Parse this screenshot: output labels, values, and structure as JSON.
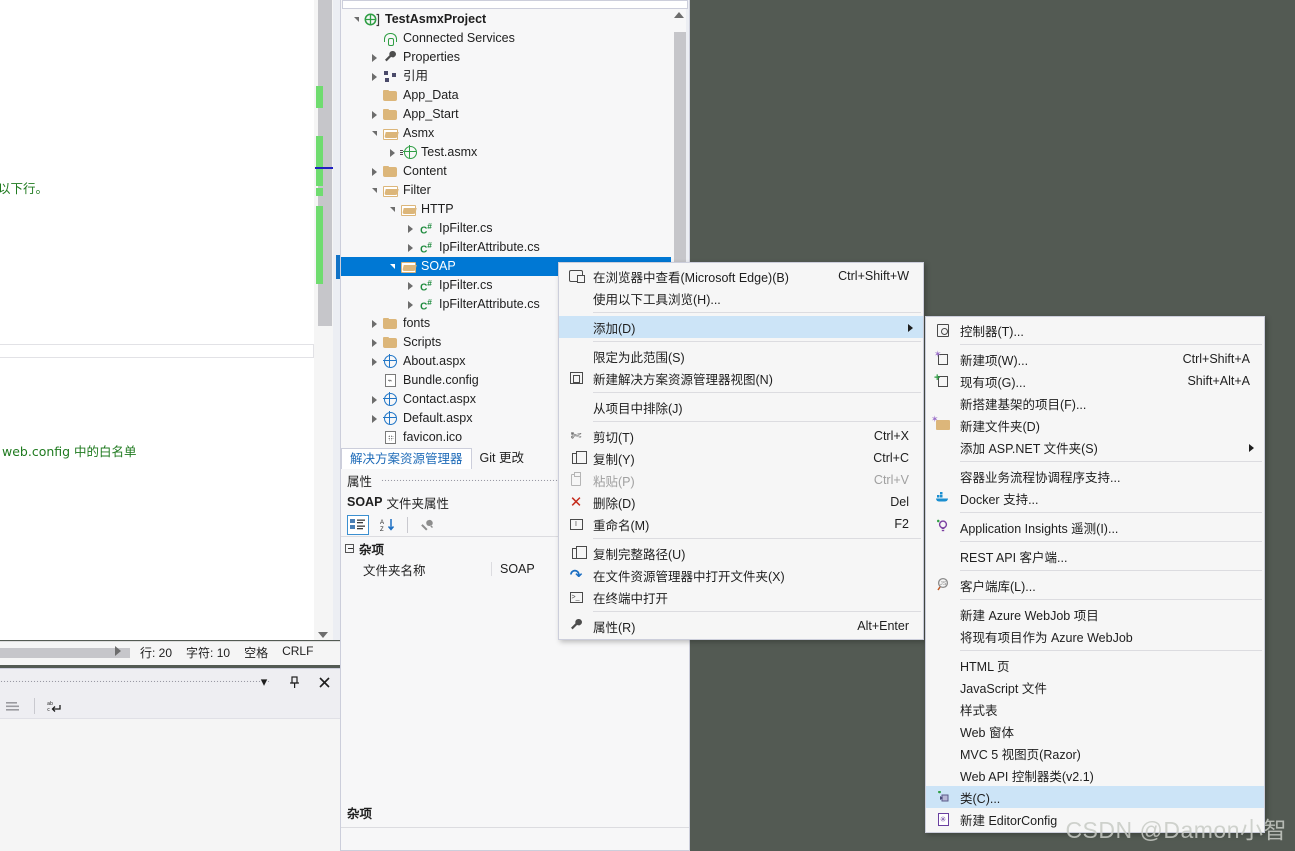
{
  "editor": {
    "comment_line_1": "以下行。",
    "comment_line_2": "web.config 中的白名单",
    "status": {
      "line_label": "行: 20",
      "char_label": "字符: 10",
      "spaces_label": "空格",
      "eol_label": "CRLF"
    }
  },
  "solution_explorer": {
    "tree": [
      {
        "indent": 0,
        "expander": "down",
        "icon": "project-icon",
        "label": "TestAsmxProject",
        "bold": true
      },
      {
        "indent": 1,
        "expander": "none",
        "icon": "connected-services-icon",
        "label": "Connected Services"
      },
      {
        "indent": 1,
        "expander": "right",
        "icon": "wrench-icon",
        "label": "Properties"
      },
      {
        "indent": 1,
        "expander": "right",
        "icon": "references-icon",
        "label": "引用"
      },
      {
        "indent": 1,
        "expander": "none",
        "icon": "folder-icon",
        "label": "App_Data"
      },
      {
        "indent": 1,
        "expander": "right",
        "icon": "folder-icon",
        "label": "App_Start"
      },
      {
        "indent": 1,
        "expander": "down",
        "icon": "folder-open-icon",
        "label": "Asmx"
      },
      {
        "indent": 2,
        "expander": "right",
        "icon": "asmx-icon",
        "label": "Test.asmx"
      },
      {
        "indent": 1,
        "expander": "right",
        "icon": "folder-icon",
        "label": "Content"
      },
      {
        "indent": 1,
        "expander": "down",
        "icon": "folder-open-icon",
        "label": "Filter"
      },
      {
        "indent": 2,
        "expander": "down",
        "icon": "folder-open-icon",
        "label": "HTTP"
      },
      {
        "indent": 3,
        "expander": "right",
        "icon": "csharp-icon",
        "label": "IpFilter.cs"
      },
      {
        "indent": 3,
        "expander": "right",
        "icon": "csharp-icon",
        "label": "IpFilterAttribute.cs"
      },
      {
        "indent": 2,
        "expander": "down",
        "icon": "folder-open-icon",
        "label": "SOAP",
        "selected": true
      },
      {
        "indent": 3,
        "expander": "right",
        "icon": "csharp-icon",
        "label": "IpFilter.cs"
      },
      {
        "indent": 3,
        "expander": "right",
        "icon": "csharp-icon",
        "label": "IpFilterAttribute.cs"
      },
      {
        "indent": 1,
        "expander": "right",
        "icon": "folder-icon",
        "label": "fonts"
      },
      {
        "indent": 1,
        "expander": "right",
        "icon": "folder-icon",
        "label": "Scripts"
      },
      {
        "indent": 1,
        "expander": "right",
        "icon": "aspx-icon",
        "label": "About.aspx"
      },
      {
        "indent": 1,
        "expander": "none",
        "icon": "config-icon",
        "label": "Bundle.config"
      },
      {
        "indent": 1,
        "expander": "right",
        "icon": "aspx-icon",
        "label": "Contact.aspx"
      },
      {
        "indent": 1,
        "expander": "right",
        "icon": "aspx-icon",
        "label": "Default.aspx"
      },
      {
        "indent": 1,
        "expander": "none",
        "icon": "favicon-icon",
        "label": "favicon.ico"
      }
    ],
    "tabs": [
      {
        "label": "解决方案资源管理器",
        "active": true
      },
      {
        "label": "Git 更改",
        "active": false
      }
    ]
  },
  "properties_window": {
    "title": "属性",
    "object_name": "SOAP",
    "object_kind": "文件夹属性",
    "category": "杂项",
    "rows": [
      {
        "key": "文件夹名称",
        "value": "SOAP"
      }
    ],
    "footer_label": "杂项"
  },
  "context_menu": {
    "items": [
      {
        "icon": "browser-icon",
        "label": "在浏览器中查看(Microsoft Edge)(B)",
        "shortcut": "Ctrl+Shift+W"
      },
      {
        "icon": "none",
        "label": "使用以下工具浏览(H)...",
        "shortcut": ""
      },
      {
        "type": "separator"
      },
      {
        "icon": "none",
        "label": "添加(D)",
        "shortcut": "",
        "highlighted": true,
        "submenu": true
      },
      {
        "type": "separator"
      },
      {
        "icon": "none",
        "label": "限定为此范围(S)",
        "shortcut": ""
      },
      {
        "icon": "new-view-icon",
        "label": "新建解决方案资源管理器视图(N)",
        "shortcut": ""
      },
      {
        "type": "separator"
      },
      {
        "icon": "none",
        "label": "从项目中排除(J)",
        "shortcut": ""
      },
      {
        "type": "separator"
      },
      {
        "icon": "scissors-icon",
        "label": "剪切(T)",
        "shortcut": "Ctrl+X"
      },
      {
        "icon": "copy-icon",
        "label": "复制(Y)",
        "shortcut": "Ctrl+C"
      },
      {
        "icon": "paste-icon",
        "label": "粘贴(P)",
        "shortcut": "Ctrl+V",
        "disabled": true
      },
      {
        "icon": "delete-icon",
        "label": "删除(D)",
        "shortcut": "Del"
      },
      {
        "icon": "rename-icon",
        "label": "重命名(M)",
        "shortcut": "F2"
      },
      {
        "type": "separator"
      },
      {
        "icon": "copy-icon",
        "label": "复制完整路径(U)",
        "shortcut": ""
      },
      {
        "icon": "open-folder-icon",
        "label": "在文件资源管理器中打开文件夹(X)",
        "shortcut": ""
      },
      {
        "icon": "terminal-icon",
        "label": "在终端中打开",
        "shortcut": ""
      },
      {
        "type": "separator"
      },
      {
        "icon": "wrench-icon",
        "label": "属性(R)",
        "shortcut": "Alt+Enter"
      }
    ]
  },
  "add_submenu": {
    "items": [
      {
        "icon": "controller-icon",
        "label": "控制器(T)...",
        "shortcut": ""
      },
      {
        "type": "separator"
      },
      {
        "icon": "new-item-icon",
        "label": "新建项(W)...",
        "shortcut": "Ctrl+Shift+A"
      },
      {
        "icon": "existing-item-icon",
        "label": "现有项(G)...",
        "shortcut": "Shift+Alt+A"
      },
      {
        "icon": "none",
        "label": "新搭建基架的项目(F)...",
        "shortcut": ""
      },
      {
        "icon": "new-folder-icon",
        "label": "新建文件夹(D)",
        "shortcut": ""
      },
      {
        "icon": "none",
        "label": "添加 ASP.NET 文件夹(S)",
        "shortcut": "",
        "submenu": true
      },
      {
        "type": "separator"
      },
      {
        "icon": "none",
        "label": "容器业务流程协调程序支持...",
        "shortcut": ""
      },
      {
        "icon": "docker-icon",
        "label": "Docker 支持...",
        "shortcut": ""
      },
      {
        "type": "separator"
      },
      {
        "icon": "app-insights-icon",
        "label": "Application Insights 遥测(I)...",
        "shortcut": ""
      },
      {
        "type": "separator"
      },
      {
        "icon": "none",
        "label": "REST API 客户端...",
        "shortcut": ""
      },
      {
        "type": "separator"
      },
      {
        "icon": "client-library-icon",
        "label": "客户端库(L)...",
        "shortcut": ""
      },
      {
        "type": "separator"
      },
      {
        "icon": "none",
        "label": "新建 Azure WebJob 项目",
        "shortcut": ""
      },
      {
        "icon": "none",
        "label": "将现有项目作为 Azure WebJob",
        "shortcut": ""
      },
      {
        "type": "separator"
      },
      {
        "icon": "none",
        "label": "HTML 页",
        "shortcut": ""
      },
      {
        "icon": "none",
        "label": "JavaScript 文件",
        "shortcut": ""
      },
      {
        "icon": "none",
        "label": "样式表",
        "shortcut": ""
      },
      {
        "icon": "none",
        "label": "Web 窗体",
        "shortcut": ""
      },
      {
        "icon": "none",
        "label": "MVC 5 视图页(Razor)",
        "shortcut": ""
      },
      {
        "icon": "none",
        "label": "Web API 控制器类(v2.1)",
        "shortcut": ""
      },
      {
        "icon": "class-icon",
        "label": "类(C)...",
        "shortcut": "",
        "highlighted": true
      },
      {
        "icon": "editorconfig-icon",
        "label": "新建 EditorConfig",
        "shortcut": ""
      }
    ]
  },
  "bottom_panel": {
    "close_label": "✕",
    "pin_label": "▯",
    "dropdown_label": "▾"
  },
  "watermark": "CSDN @Damon小智",
  "colors": {
    "workspace_bg": "#535a53",
    "selection_blue": "#0078d4",
    "menu_highlight": "#cce4f7",
    "comment_green": "#1f7a1f",
    "folder_gold": "#dcb67a"
  }
}
